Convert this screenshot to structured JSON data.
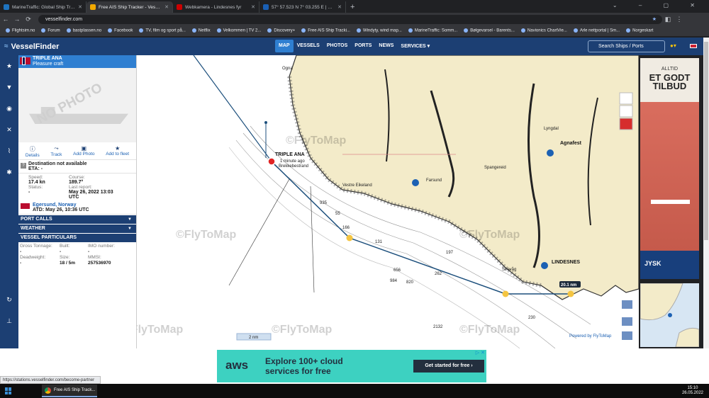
{
  "browser": {
    "tabs": [
      {
        "title": "MarineTraffic: Global Ship Tracki...",
        "color": "#1e73be"
      },
      {
        "title": "Free AIS Ship Tracker - VesselFin...",
        "color": "#f2a900",
        "active": true
      },
      {
        "title": "Webkamera - Lindesnes fyr",
        "color": "#cc0000"
      },
      {
        "title": "57° 57.523 N 7° 03.255 E | Bølg...",
        "color": "#1a5fb4"
      }
    ],
    "url": "vesselfinder.com",
    "bookmarks": [
      "Flightsim.no",
      "Forum",
      "bastplassen.no",
      "Facebook",
      "TV, film og sport på...",
      "Netflix",
      "Velkommen | TV 2...",
      "Discovery+",
      "Free AIS Ship Tracki...",
      "Windyty, wind map...",
      "MarineTraffic: Somm...",
      "Bølgevarsel - Barents...",
      "Navionics ChartVie...",
      "Arle nettportal | Sm...",
      "Norgeskart"
    ]
  },
  "site": {
    "logo": "VesselFinder",
    "menu": [
      "MAP",
      "VESSELS",
      "PHOTOS",
      "PORTS",
      "NEWS",
      "SERVICES ▾"
    ],
    "search_placeholder": "Search Ships  /  Ports"
  },
  "vessel": {
    "name": "TRIPLE ANA",
    "type": "Pleasure craft",
    "no_photo": "NO PHOTO",
    "actions": [
      {
        "icon": "info-icon",
        "label": "Details"
      },
      {
        "icon": "track-icon",
        "label": "Track"
      },
      {
        "icon": "camera-icon",
        "label": "Add Photo"
      },
      {
        "icon": "star-icon",
        "label": "Add to fleet"
      }
    ],
    "destination": "Destination not available",
    "eta": "ETA: -",
    "speed_label": "Speed:",
    "speed": "17.4 kn",
    "course_label": "Course:",
    "course": "189.7°",
    "draught_label": "Draught:",
    "draught": "-",
    "status_label": "Status:",
    "status": "-",
    "report_label": "Last report:",
    "report": "May 26, 2022 13:03 UTC",
    "departure_port": "Egersund, Norway",
    "atd": "ATD: May 26, 10:36 UTC",
    "sections": [
      "PORT CALLS",
      "WEATHER",
      "VESSEL PARTICULARS"
    ],
    "particulars": [
      {
        "label": "Gross Tonnage:",
        "value": "-"
      },
      {
        "label": "Built:",
        "value": "-"
      },
      {
        "label": "IMO number:",
        "value": "-"
      },
      {
        "label": "Deadweight:",
        "value": "-"
      },
      {
        "label": "Size:",
        "value": "18 / 5m"
      },
      {
        "label": "MMSI:",
        "value": "257536970"
      }
    ]
  },
  "map": {
    "watermark": "©FlyToMap",
    "ship_label": "TRIPLE ANA",
    "ship_time": "1 minute ago",
    "places": [
      "Ogna",
      "Brekkebestrand",
      "Agnafest",
      "Lyngdal",
      "LINDESNES",
      "Spangereid",
      "Farsund",
      "Hidrasundet",
      "Sirevåg",
      "Vestre Eikeland"
    ],
    "depths": [
      "935",
      "55",
      "131",
      "656",
      "984",
      "820",
      "262",
      "197",
      "2132",
      "230",
      "166"
    ],
    "measure": "20.1 nm",
    "scale": "2 nm",
    "credit": "Powered by FlyToMap"
  },
  "ads": {
    "right_line1": "ALLTID",
    "right_line2": "ET GODT",
    "right_line3": "TILBUD",
    "right_brand": "JYSK",
    "aws_logo": "aws",
    "aws_text1": "Explore 100+ cloud",
    "aws_text2": "services for free",
    "aws_cta": "Get started for free ›"
  },
  "status_url": "https://stations.vesselfinder.com/become-partner",
  "taskbar": {
    "app": "Free AIS Ship Track...",
    "time": "15:10",
    "date": "26.05.2022"
  }
}
